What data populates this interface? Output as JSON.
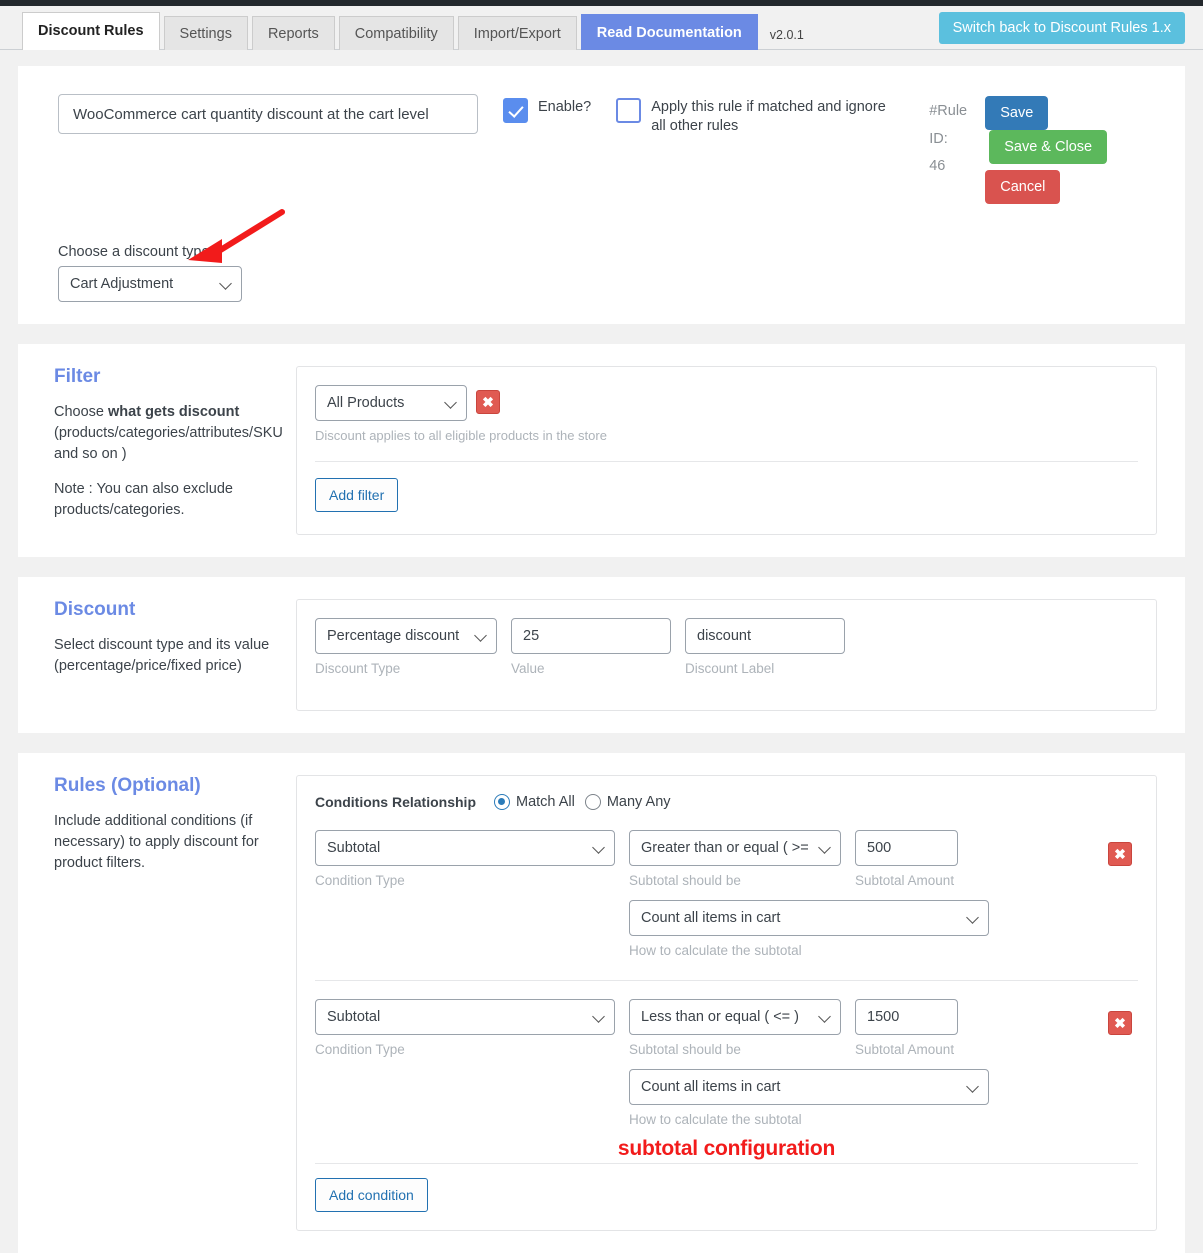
{
  "tabs": [
    {
      "label": "Discount Rules",
      "state": "active"
    },
    {
      "label": "Settings",
      "state": "normal"
    },
    {
      "label": "Reports",
      "state": "normal"
    },
    {
      "label": "Compatibility",
      "state": "normal"
    },
    {
      "label": "Import/Export",
      "state": "normal"
    },
    {
      "label": "Read Documentation",
      "state": "doc"
    }
  ],
  "version": "v2.0.1",
  "switch_button": "Switch back to Discount Rules 1.x",
  "header": {
    "rule_name_value": "WooCommerce cart quantity discount at the cart level",
    "rule_name_placeholder": "Enter rule name",
    "enable_label": "Enable?",
    "enable_checked": true,
    "exclusive_label": "Apply this rule if matched and ignore all other rules",
    "exclusive_checked": false,
    "rule_id_label": "#Rule ID:",
    "rule_id_value": "46",
    "save_label": "Save",
    "save_close_label": "Save & Close",
    "cancel_label": "Cancel",
    "discount_type_label": "Choose a discount type",
    "discount_type_value": "Cart Adjustment"
  },
  "filter": {
    "title": "Filter",
    "desc_1_pre": "Choose ",
    "desc_1_bold": "what gets discount",
    "desc_1_post": " (products/categories/attributes/SKU and so on )",
    "desc_2": "Note : You can also exclude products/categories.",
    "select_value": "All Products",
    "hint": "Discount applies to all eligible products in the store",
    "add_button": "Add filter",
    "remove_icon": "✖"
  },
  "discount": {
    "title": "Discount",
    "desc": "Select discount type and its value (percentage/price/fixed price)",
    "type_value": "Percentage discount",
    "type_sublabel": "Discount Type",
    "value_value": "25",
    "value_sublabel": "Value",
    "label_value": "discount",
    "label_sublabel": "Discount Label"
  },
  "rules": {
    "title": "Rules (Optional)",
    "desc": "Include additional conditions (if necessary) to apply discount for product filters.",
    "relationship_label": "Conditions Relationship",
    "match_all_label": "Match All",
    "many_any_label": "Many Any",
    "match_all_selected": true,
    "conditions": [
      {
        "type_value": "Subtotal",
        "type_sublabel": "Condition Type",
        "operator_value": "Greater than or equal ( >= )",
        "operator_sublabel": "Subtotal should be",
        "amount_value": "500",
        "amount_sublabel": "Subtotal Amount",
        "calc_value": "Count all items in cart",
        "calc_sublabel": "How to calculate the subtotal",
        "remove_icon": "✖"
      },
      {
        "type_value": "Subtotal",
        "type_sublabel": "Condition Type",
        "operator_value": "Less than or equal ( <= )",
        "operator_sublabel": "Subtotal should be",
        "amount_value": "1500",
        "amount_sublabel": "Subtotal Amount",
        "calc_value": "Count all items in cart",
        "calc_sublabel": "How to calculate the subtotal",
        "remove_icon": "✖"
      }
    ],
    "annotation_text": "subtotal configuration",
    "add_button": "Add condition"
  },
  "colors": {
    "accent_blue": "#6b8ae4",
    "save_blue": "#337ab7",
    "green": "#5cb85c",
    "red": "#d9534f",
    "cyan": "#5bc0de",
    "annotation_red": "#f21b1b"
  }
}
